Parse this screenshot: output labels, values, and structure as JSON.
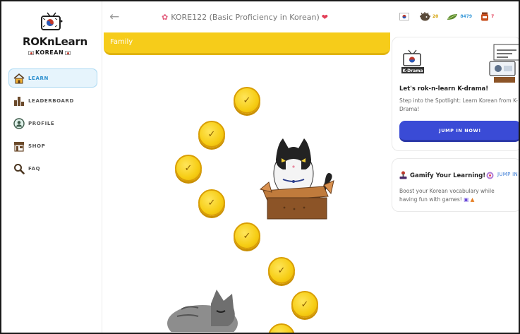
{
  "logo": {
    "title": "ROKnLearn",
    "subtitle": "KOREAN"
  },
  "sidebar": {
    "items": [
      {
        "label": "LEARN",
        "icon": "house-icon",
        "active": true
      },
      {
        "label": "LEADERBOARD",
        "icon": "leaderboard-icon",
        "active": false
      },
      {
        "label": "PROFILE",
        "icon": "profile-icon",
        "active": false
      },
      {
        "label": "SHOP",
        "icon": "shop-icon",
        "active": false
      },
      {
        "label": "FAQ",
        "icon": "magnifier-icon",
        "active": false
      }
    ]
  },
  "header": {
    "back_icon": "back-arrow-icon",
    "course_title": "KORE122 (Basic Proficiency in Korean)",
    "stats": {
      "flag": "korean-flag-icon",
      "streak": {
        "icon": "hedgehog-icon",
        "value": "20",
        "color": "#d4a20a"
      },
      "gems": {
        "icon": "leaf-gem-icon",
        "value": "8479",
        "color": "#3a9ad9"
      },
      "hearts": {
        "icon": "jar-icon",
        "value": "7",
        "color": "#e23e57"
      }
    }
  },
  "unit": {
    "subtitle": "Family",
    "color": "#f6cc1a"
  },
  "lesson_path": {
    "completed_count": 8,
    "check_icon": "check-icon"
  },
  "promo": {
    "kdrama": {
      "badge": "K-Drama",
      "title": "Let's rok-n-learn K-drama!",
      "description": "Step into the Spotlight: Learn Korean from K-Drama!",
      "button": "JUMP IN NOW!",
      "button_color": "#3a4bd6"
    },
    "gamify": {
      "title": "Gamify Your Learning!",
      "link": "JUMP IN!",
      "description": "Boost your Korean vocabulary while having fun with games!"
    }
  }
}
